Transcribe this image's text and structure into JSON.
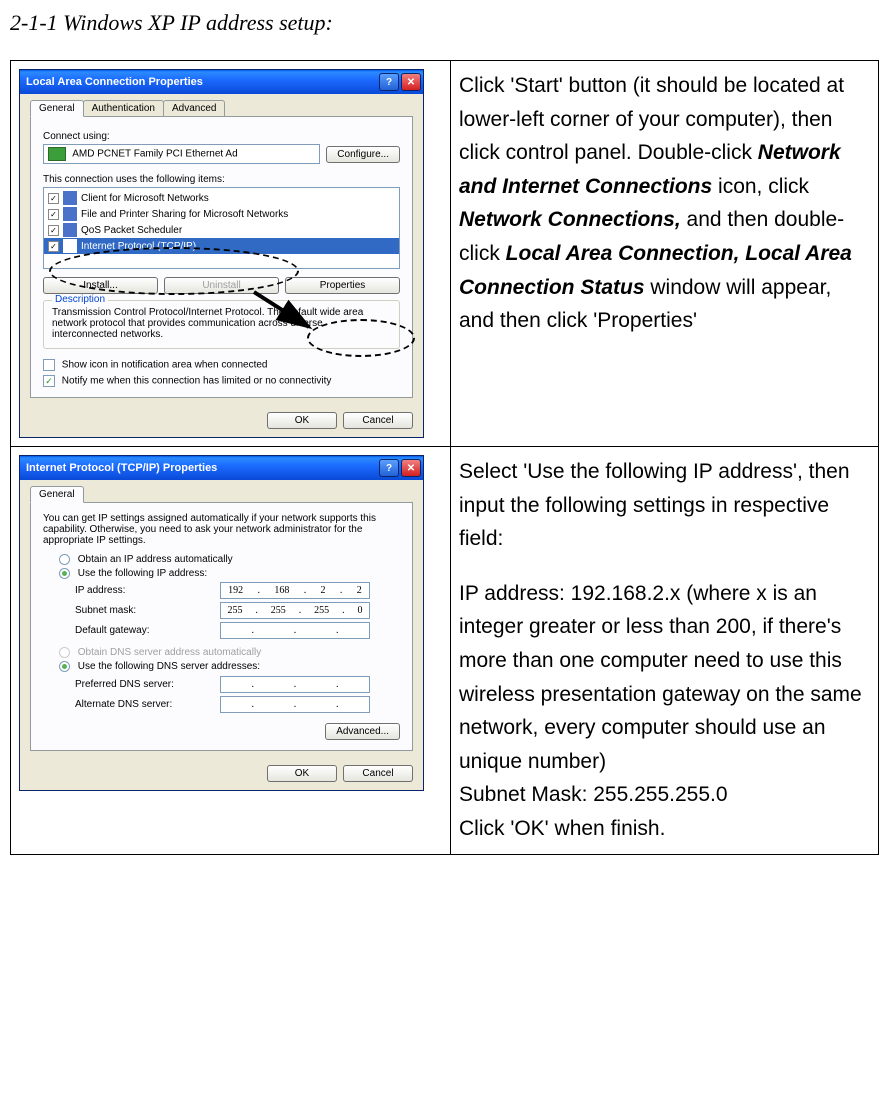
{
  "section_title": "2-1-1 Windows XP IP address setup:",
  "row1": {
    "dialog": {
      "title": "Local Area Connection Properties",
      "tabs": [
        "General",
        "Authentication",
        "Advanced"
      ],
      "connect_using_label": "Connect using:",
      "adapter": "AMD PCNET Family PCI Ethernet Ad",
      "configure_btn": "Configure...",
      "items_label": "This connection uses the following items:",
      "items": [
        "Client for Microsoft Networks",
        "File and Printer Sharing for Microsoft Networks",
        "QoS Packet Scheduler",
        "Internet Protocol (TCP/IP)"
      ],
      "install_btn": "Install...",
      "uninstall_btn": "Uninstall",
      "properties_btn": "Properties",
      "desc_legend": "Description",
      "desc_text": "Transmission Control Protocol/Internet Protocol. The default wide area network protocol that provides communication across diverse interconnected networks.",
      "chk1": "Show icon in notification area when connected",
      "chk2": "Notify me when this connection has limited or no connectivity",
      "ok": "OK",
      "cancel": "Cancel"
    },
    "instruction": {
      "p1a": "Click 'Start' button (it should be located at lower-left corner of your computer), then click control panel. Double-click ",
      "b1": "Network and Internet Connections",
      "p1b": " icon, click ",
      "b2": "Network Connections,",
      "p1c": " and then double-click ",
      "b3": "Local Area Connection, Local Area Connection Status",
      "p1d": " window will appear, and then click 'Properties'"
    }
  },
  "row2": {
    "dialog": {
      "title": "Internet Protocol (TCP/IP) Properties",
      "tab": "General",
      "intro": "You can get IP settings assigned automatically if your network supports this capability. Otherwise, you need to ask your network administrator for the appropriate IP settings.",
      "radio_auto_ip": "Obtain an IP address automatically",
      "radio_use_ip": "Use the following IP address:",
      "ip_label": "IP address:",
      "ip_value": [
        "192",
        "168",
        "2",
        "2"
      ],
      "subnet_label": "Subnet mask:",
      "subnet_value": [
        "255",
        "255",
        "255",
        "0"
      ],
      "gateway_label": "Default gateway:",
      "gateway_value": [
        "",
        "",
        "",
        ""
      ],
      "radio_auto_dns": "Obtain DNS server address automatically",
      "radio_use_dns": "Use the following DNS server addresses:",
      "pref_dns_label": "Preferred DNS server:",
      "alt_dns_label": "Alternate DNS server:",
      "advanced_btn": "Advanced...",
      "ok": "OK",
      "cancel": "Cancel"
    },
    "instruction": {
      "p1": "Select 'Use the following IP address', then input the following settings in respective field:",
      "p2": "IP address: 192.168.2.x (where x is an integer greater or less than 200, if there's more than one computer need to use this wireless presentation gateway on the same network, every computer should use an unique number)",
      "p3": "Subnet Mask: 255.255.255.0",
      "p4": "Click 'OK' when finish."
    }
  }
}
